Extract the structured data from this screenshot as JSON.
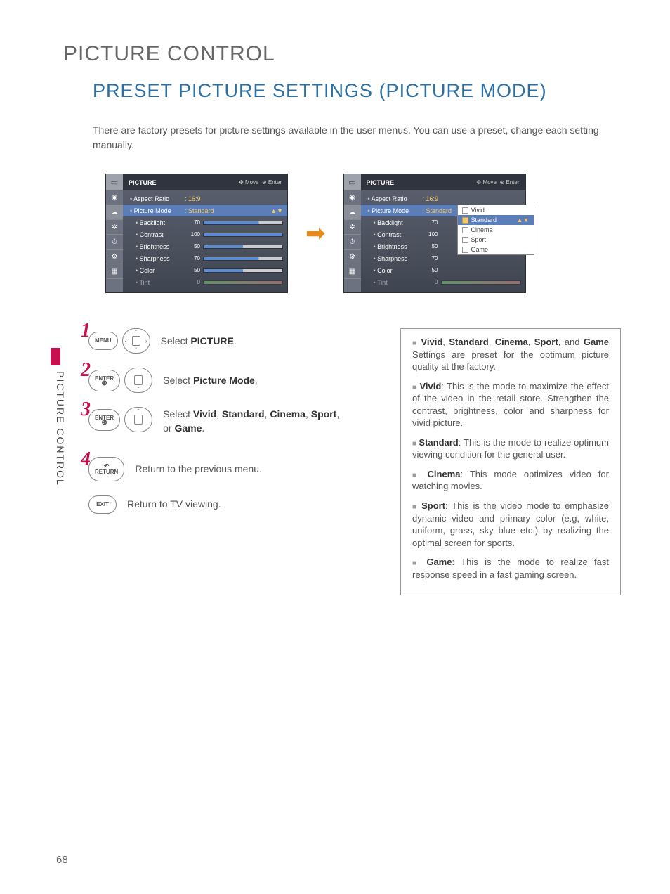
{
  "page": {
    "number": "68",
    "sideTab": "PICTURE CONTROL",
    "title1": "PICTURE CONTROL",
    "title2": "PRESET PICTURE SETTINGS (PICTURE MODE)",
    "intro": "There are factory presets for picture settings available in the user menus. You can use a preset, change each setting manually."
  },
  "osd": {
    "header": "PICTURE",
    "hints": {
      "move": "Move",
      "enter": "Enter"
    },
    "aspect": {
      "label": "Aspect Ratio",
      "value": ": 16:9"
    },
    "mode": {
      "label": "Picture Mode",
      "value": ": Standard"
    },
    "params": [
      {
        "label": "Backlight",
        "value": "70",
        "pct": 70
      },
      {
        "label": "Contrast",
        "value": "100",
        "pct": 100
      },
      {
        "label": "Brightness",
        "value": "50",
        "pct": 50
      },
      {
        "label": "Sharpness",
        "value": "70",
        "pct": 70
      },
      {
        "label": "Color",
        "value": "50",
        "pct": 50
      },
      {
        "label": "Tint",
        "value": "0",
        "pct": 50
      }
    ],
    "popup": [
      "Vivid",
      "Standard",
      "Cinema",
      "Sport",
      "Game"
    ],
    "popupSelected": "Standard",
    "arrow": "➡"
  },
  "steps": {
    "s1": {
      "num": "1",
      "btn": "MENU",
      "textA": "Select ",
      "bold": "PICTURE",
      "textB": "."
    },
    "s2": {
      "num": "2",
      "btn": "ENTER",
      "textA": "Select ",
      "bold": "Picture Mode",
      "textB": "."
    },
    "s3": {
      "num": "3",
      "btn": "ENTER",
      "textA": "Select ",
      "b1": "Vivid",
      "b2": "Standard",
      "b3": "Cinema",
      "b4": "Sport",
      "b5": "Game",
      "or": "or ",
      "c1": ", ",
      "c2": ", ",
      "c3": ", ",
      "c4": ", ",
      "textB": "."
    },
    "s4": {
      "num": "4",
      "btn": "RETURN",
      "text": "Return to the previous menu."
    },
    "s5": {
      "btn": "EXIT",
      "text": "Return to TV viewing."
    }
  },
  "info": {
    "i1": {
      "b": "Vivid",
      "c1": ", ",
      "b2": "Standard",
      "c2": ", ",
      "b3": "Cinema",
      "c3": ", ",
      "b4": "Sport",
      "c4": ", and ",
      "b5": "Game",
      "rest": " Settings are preset for the optimum picture quality at the factory."
    },
    "i2": {
      "b": "Vivid",
      "rest": ": This is the mode to maximize the effect of the video in the retail store. Strengthen the contrast, brightness, color and sharpness for vivid picture."
    },
    "i3": {
      "b": "Standard",
      "rest": ": This is the mode to realize optimum viewing condition for the general user."
    },
    "i4": {
      "b": "Cinema",
      "rest": ": This mode optimizes video for watching movies."
    },
    "i5": {
      "b": "Sport",
      "rest": ": This is the video mode to emphasize dynamic video and primary color (e.g, white, uniform, grass, sky blue etc.) by realizing the optimal screen for sports."
    },
    "i6": {
      "b": "Game",
      "rest": ": This is the mode to realize fast response speed in a fast gaming screen."
    }
  }
}
